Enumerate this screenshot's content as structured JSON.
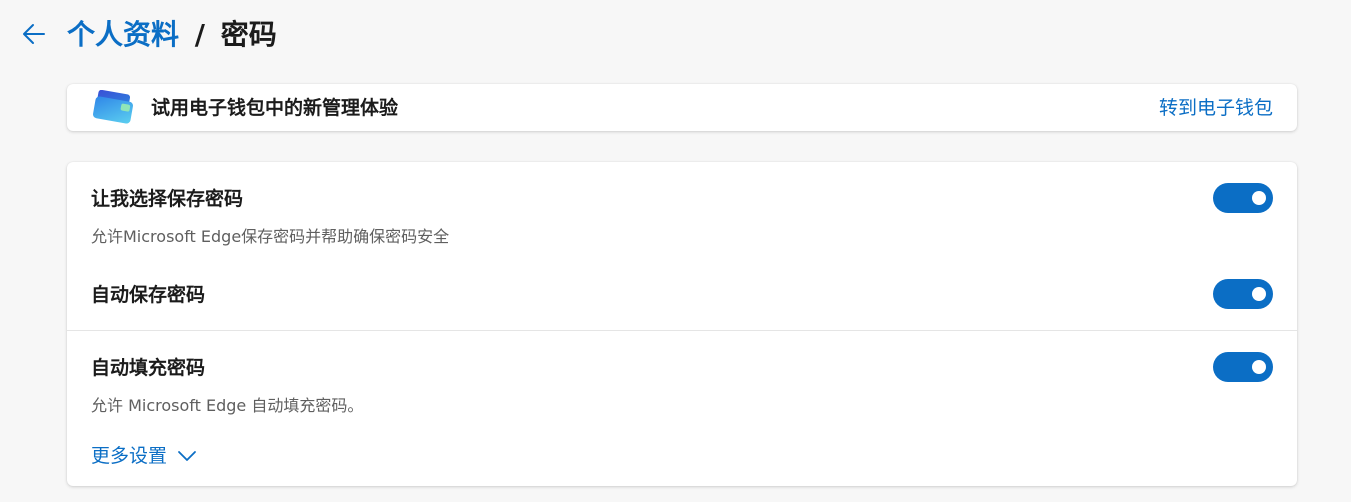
{
  "header": {
    "breadcrumb_parent": "个人资料",
    "separator": "/",
    "breadcrumb_current": "密码"
  },
  "wallet_banner": {
    "text": "试用电子钱包中的新管理体验",
    "link": "转到电子钱包"
  },
  "settings": {
    "offer_to_save": {
      "title": "让我选择保存密码",
      "description": "允许Microsoft Edge保存密码并帮助确保密码安全",
      "enabled": true
    },
    "auto_save": {
      "title": "自动保存密码",
      "enabled": true
    },
    "autofill": {
      "title": "自动填充密码",
      "description": "允许 Microsoft Edge 自动填充密码。",
      "enabled": true
    },
    "more_settings_label": "更多设置"
  },
  "colors": {
    "accent": "#0b6ec5",
    "background": "#f7f7f7",
    "card": "#ffffff"
  },
  "icons": {
    "back": "arrow-left-icon",
    "wallet": "wallet-icon",
    "chevron": "chevron-down-icon"
  }
}
